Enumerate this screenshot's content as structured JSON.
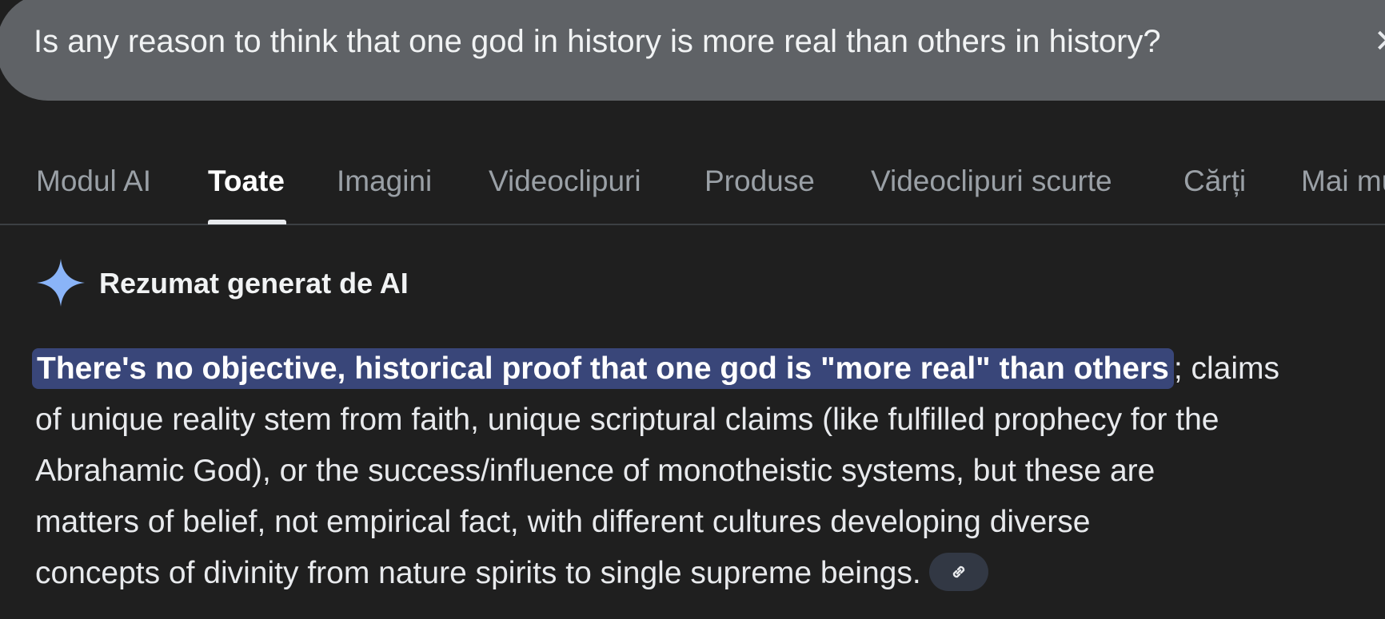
{
  "search": {
    "query": "Is any reason to think that one god in history is more real than others in history?"
  },
  "tabs": [
    {
      "label": "Modul AI",
      "active": false
    },
    {
      "label": "Toate",
      "active": true
    },
    {
      "label": "Imagini",
      "active": false
    },
    {
      "label": "Videoclipuri",
      "active": false
    },
    {
      "label": "Produse",
      "active": false
    },
    {
      "label": "Videoclipuri scurte",
      "active": false
    },
    {
      "label": "Cărți",
      "active": false
    },
    {
      "label": "Mai multe",
      "active": false
    }
  ],
  "ai_overview": {
    "title": "Rezumat generat de AI",
    "icon": "sparkle-icon",
    "highlighted_text": "There's no objective, historical proof that one god is \"more real\" than others",
    "line1_rest": "; claims",
    "line2": "of unique reality stem from faith, unique scriptural claims (like fulfilled prophecy for the",
    "line3": "Abrahamic God), or the success/influence of monotheistic systems, but these are",
    "line4": "matters of belief, not empirical fact, with different cultures developing diverse",
    "line5": "concepts of divinity from nature spirits to single supreme beings.",
    "link_icon": "link-icon"
  },
  "colors": {
    "background": "#1f1f1f",
    "search_bar": "#5f6266",
    "highlight": "#394679",
    "sparkle": "#8ab4f8",
    "link_chip": "#323844"
  }
}
